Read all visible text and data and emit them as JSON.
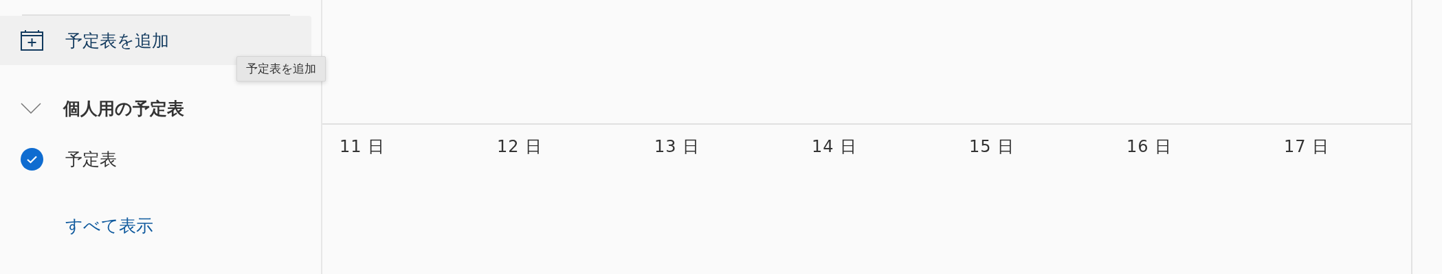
{
  "sidebar": {
    "add_calendar": {
      "label": "予定表を追加"
    },
    "tooltip": "予定表を追加",
    "group": {
      "title": "個人用の予定表",
      "expanded": true,
      "calendars": [
        {
          "name": "予定表",
          "checked": true
        }
      ]
    },
    "show_all": "すべて表示"
  },
  "calendar": {
    "days": [
      "11 日",
      "12 日",
      "13 日",
      "14 日",
      "15 日",
      "16 日",
      "17 日"
    ]
  }
}
